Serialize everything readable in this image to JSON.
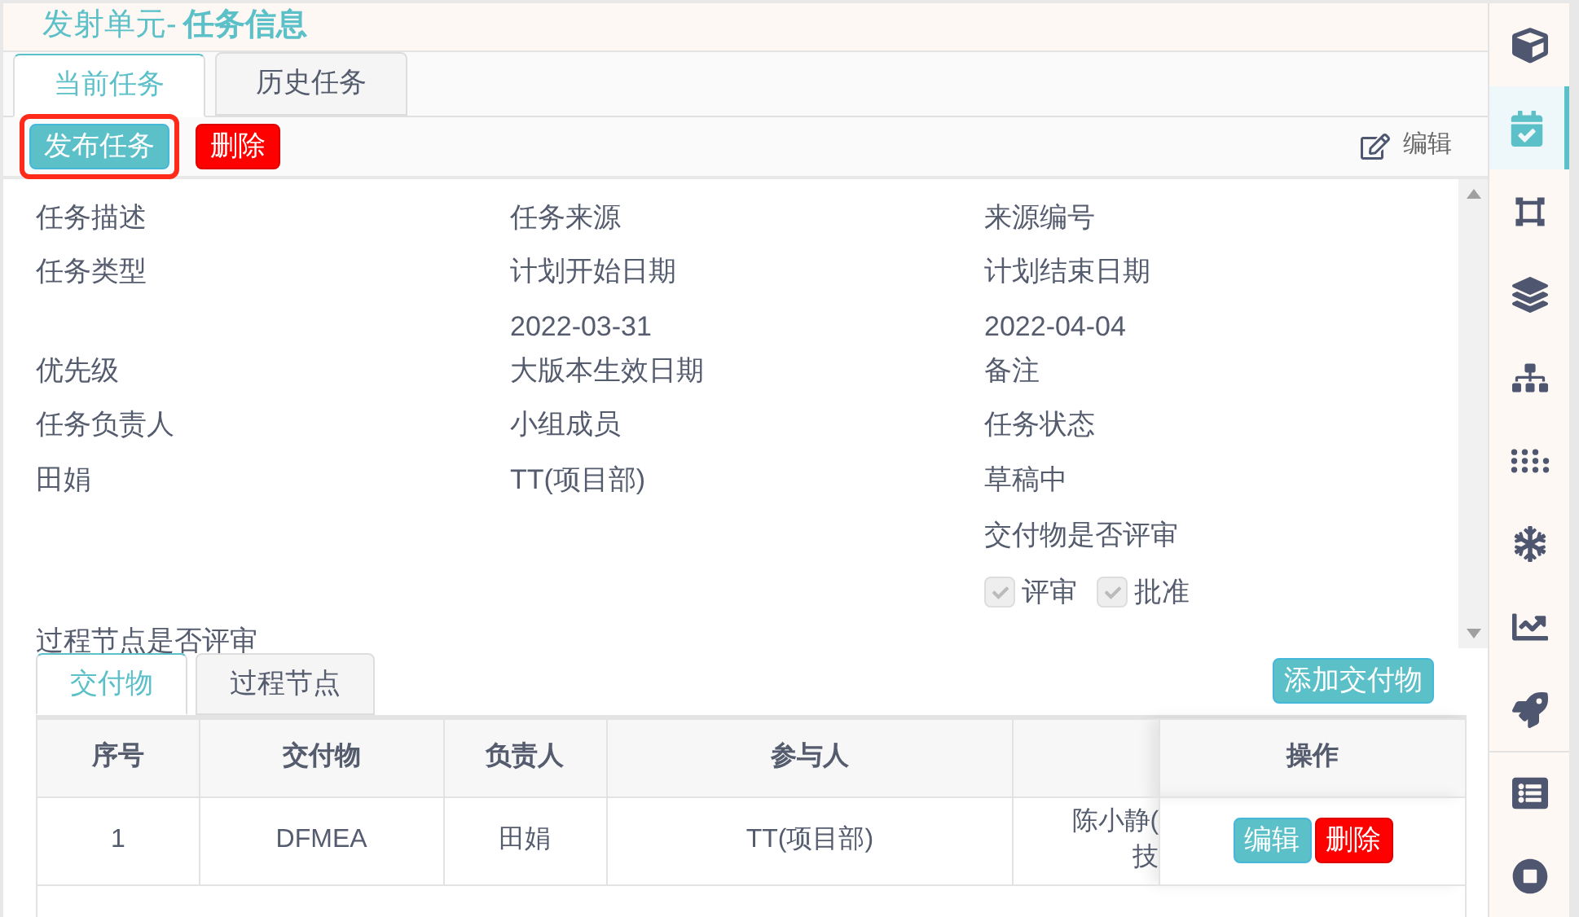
{
  "header": {
    "prefix": "发射单元-",
    "title": "任务信息"
  },
  "tabs": [
    {
      "label": "当前任务",
      "selected": true
    },
    {
      "label": "历史任务",
      "selected": false
    }
  ],
  "toolbar": {
    "buttons": [
      {
        "label": "发布任务",
        "kind": "primary",
        "highlighted": true
      },
      {
        "label": "删除",
        "kind": "danger",
        "highlighted": false
      }
    ],
    "edit": "编辑"
  },
  "form": {
    "fields": [
      {
        "label": "任务描述"
      },
      {
        "label": "任务来源"
      },
      {
        "label": "来源编号"
      },
      {
        "label": "任务类型"
      },
      {
        "label": "计划开始日期",
        "value": "2022-03-31"
      },
      {
        "label": "计划结束日期",
        "value": "2022-04-04"
      },
      {
        "label": "优先级"
      },
      {
        "label": "大版本生效日期"
      },
      {
        "label": "备注"
      },
      {
        "label": "任务负责人",
        "value": "田娟"
      },
      {
        "label": "小组成员",
        "value": "TT(项目部)"
      },
      {
        "label": "任务状态",
        "value": "草稿中"
      }
    ],
    "deliverable_review": {
      "label": "交付物是否评审",
      "options": [
        {
          "label": "评审",
          "checked": true,
          "disabled": true
        },
        {
          "label": "批准",
          "checked": true,
          "disabled": true
        }
      ]
    },
    "process_review": {
      "label": "过程节点是否评审"
    }
  },
  "sub_tabs": [
    {
      "label": "交付物",
      "selected": true
    },
    {
      "label": "过程节点",
      "selected": false
    }
  ],
  "add_button": "添加交付物",
  "table": {
    "columns": [
      "序号",
      "交付物",
      "负责人",
      "参与人",
      "",
      "操作"
    ],
    "rows": [
      {
        "cells": [
          "1",
          "DFMEA",
          "田娟",
          "TT(项目部)",
          "陈小静(\n技"
        ],
        "actions": [
          "编辑",
          "删除"
        ]
      }
    ]
  },
  "sidebar": {
    "items": [
      {
        "selected": false
      },
      {
        "selected": true
      },
      {
        "selected": false
      },
      {
        "selected": false
      },
      {
        "selected": false
      },
      {
        "selected": false
      },
      {
        "selected": false
      },
      {
        "selected": false
      },
      {
        "selected": false
      },
      {
        "selected": false
      },
      {
        "selected": false
      }
    ]
  }
}
